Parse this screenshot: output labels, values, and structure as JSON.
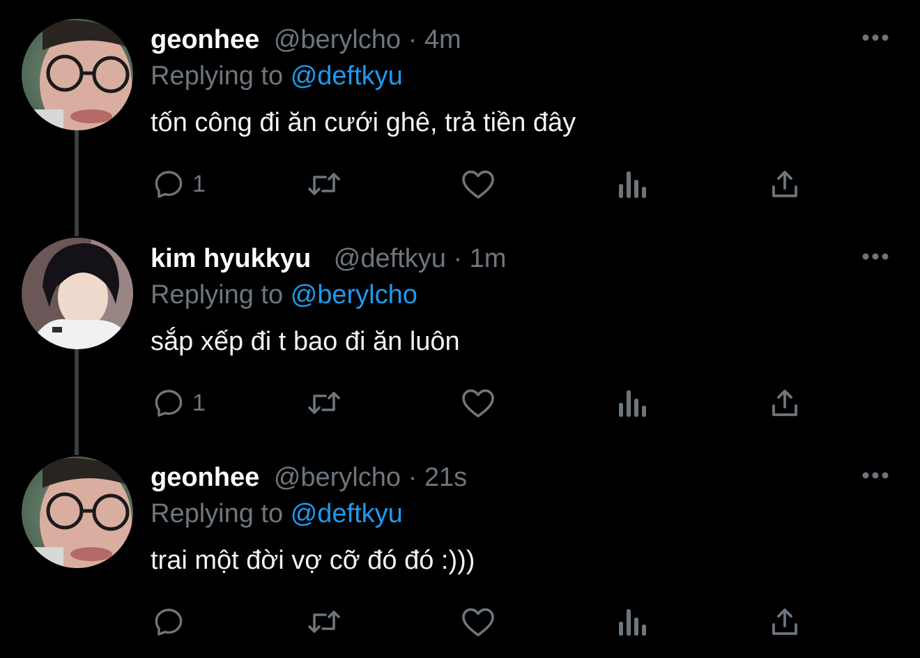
{
  "tweets": [
    {
      "author": "geonhee",
      "handle": "@berylcho",
      "separator": "·",
      "time": "4m",
      "reply_prefix": "Replying to",
      "reply_to": "@deftkyu",
      "text": "tốn công đi ăn cưới ghê, trả tiền đây",
      "reply_count": "1",
      "avatar": "geonhee-avatar"
    },
    {
      "author": "kim hyukkyu",
      "handle": "@deftkyu",
      "separator": "·",
      "time": "1m",
      "reply_prefix": "Replying to",
      "reply_to": "@berylcho",
      "text": "sắp xếp đi t bao đi ăn luôn",
      "reply_count": "1",
      "avatar": "hyukkyu-avatar"
    },
    {
      "author": "geonhee",
      "handle": "@berylcho",
      "separator": "·",
      "time": "21s",
      "reply_prefix": "Replying to",
      "reply_to": "@deftkyu",
      "text": "trai một đời vợ cỡ đó đó :)))",
      "reply_count": "",
      "avatar": "geonhee-avatar"
    }
  ],
  "icons": {
    "reply": "reply-icon",
    "retweet": "retweet-icon",
    "like": "heart-icon",
    "views": "views-icon",
    "share": "share-icon",
    "more": "more-options-icon"
  },
  "colors": {
    "background": "#000000",
    "name": "#ffffff",
    "muted": "#6e767d",
    "mention": "#1d9bf0",
    "thread_line": "#3b3f44"
  }
}
